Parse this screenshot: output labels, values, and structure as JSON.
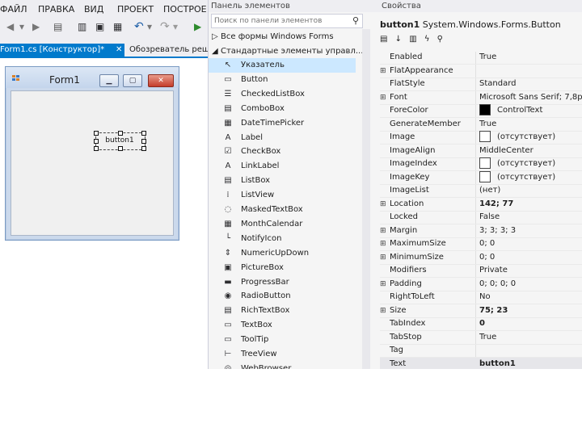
{
  "menu": [
    "ФАЙЛ",
    "ПРАВКА",
    "ВИД",
    "ПРОЕКТ",
    "ПОСТРОЕ"
  ],
  "tabs": {
    "active": "Form1.cs [Конструктор]*",
    "inactive": "Обозреватель реш"
  },
  "form": {
    "title": "Form1",
    "button_text": "button1"
  },
  "toolbox": {
    "header": "Панель элементов",
    "search_placeholder": "Поиск по панели элементов",
    "group_collapsed": "Все формы Windows Forms",
    "group_expanded": "Стандартные элементы управл...",
    "items": [
      {
        "label": "Указатель",
        "icon": "pointer-icon",
        "glyph": "↖"
      },
      {
        "label": "Button",
        "icon": "button-icon",
        "glyph": "▭"
      },
      {
        "label": "CheckedListBox",
        "icon": "checkedlistbox-icon",
        "glyph": "☰"
      },
      {
        "label": "ComboBox",
        "icon": "combobox-icon",
        "glyph": "▤"
      },
      {
        "label": "DateTimePicker",
        "icon": "calendar-icon",
        "glyph": "▦"
      },
      {
        "label": "Label",
        "icon": "label-icon",
        "glyph": "A"
      },
      {
        "label": "CheckBox",
        "icon": "checkbox-icon",
        "glyph": "☑"
      },
      {
        "label": "LinkLabel",
        "icon": "linklabel-icon",
        "glyph": "A"
      },
      {
        "label": "ListBox",
        "icon": "listbox-icon",
        "glyph": "▤"
      },
      {
        "label": "ListView",
        "icon": "listview-icon",
        "glyph": "⁞"
      },
      {
        "label": "MaskedTextBox",
        "icon": "maskedtextbox-icon",
        "glyph": "◌"
      },
      {
        "label": "MonthCalendar",
        "icon": "monthcalendar-icon",
        "glyph": "▦"
      },
      {
        "label": "NotifyIcon",
        "icon": "notifyicon-icon",
        "glyph": "└"
      },
      {
        "label": "NumericUpDown",
        "icon": "numericupdown-icon",
        "glyph": "⇕"
      },
      {
        "label": "PictureBox",
        "icon": "picturebox-icon",
        "glyph": "▣"
      },
      {
        "label": "ProgressBar",
        "icon": "progressbar-icon",
        "glyph": "▬"
      },
      {
        "label": "RadioButton",
        "icon": "radiobutton-icon",
        "glyph": "◉"
      },
      {
        "label": "RichTextBox",
        "icon": "richtextbox-icon",
        "glyph": "▤"
      },
      {
        "label": "TextBox",
        "icon": "textbox-icon",
        "glyph": "▭"
      },
      {
        "label": "ToolTip",
        "icon": "tooltip-icon",
        "glyph": "▭"
      },
      {
        "label": "TreeView",
        "icon": "treeview-icon",
        "glyph": "⊢"
      },
      {
        "label": "WebBrowser",
        "icon": "webbrowser-icon",
        "glyph": "◎"
      }
    ]
  },
  "properties": {
    "header": "Свойства",
    "object_name": "button1",
    "object_type": "System.Windows.Forms.Button",
    "rows": [
      {
        "name": "Enabled",
        "value": "True",
        "expander": ""
      },
      {
        "name": "FlatAppearance",
        "value": "",
        "expander": "⊞"
      },
      {
        "name": "FlatStyle",
        "value": "Standard",
        "expander": ""
      },
      {
        "name": "Font",
        "value": "Microsoft Sans Serif; 7,8pt",
        "expander": "⊞"
      },
      {
        "name": "ForeColor",
        "value": "ControlText",
        "expander": "",
        "swatch": "#000000"
      },
      {
        "name": "GenerateMember",
        "value": "True",
        "expander": ""
      },
      {
        "name": "Image",
        "value": "(отсутствует)",
        "expander": "",
        "swatch": "#ffffff"
      },
      {
        "name": "ImageAlign",
        "value": "MiddleCenter",
        "expander": ""
      },
      {
        "name": "ImageIndex",
        "value": "(отсутствует)",
        "expander": "",
        "swatch": "#ffffff"
      },
      {
        "name": "ImageKey",
        "value": "(отсутствует)",
        "expander": "",
        "swatch": "#ffffff"
      },
      {
        "name": "ImageList",
        "value": "(нет)",
        "expander": ""
      },
      {
        "name": "Location",
        "value": "142; 77",
        "expander": "⊞",
        "bold": true
      },
      {
        "name": "Locked",
        "value": "False",
        "expander": ""
      },
      {
        "name": "Margin",
        "value": "3; 3; 3; 3",
        "expander": "⊞"
      },
      {
        "name": "MaximumSize",
        "value": "0; 0",
        "expander": "⊞"
      },
      {
        "name": "MinimumSize",
        "value": "0; 0",
        "expander": "⊞"
      },
      {
        "name": "Modifiers",
        "value": "Private",
        "expander": ""
      },
      {
        "name": "Padding",
        "value": "0; 0; 0; 0",
        "expander": "⊞"
      },
      {
        "name": "RightToLeft",
        "value": "No",
        "expander": ""
      },
      {
        "name": "Size",
        "value": "75; 23",
        "expander": "⊞",
        "bold": true
      },
      {
        "name": "TabIndex",
        "value": "0",
        "expander": "",
        "bold": true
      },
      {
        "name": "TabStop",
        "value": "True",
        "expander": ""
      },
      {
        "name": "Tag",
        "value": "",
        "expander": ""
      },
      {
        "name": "Text",
        "value": "button1",
        "expander": "",
        "bold": true
      }
    ]
  },
  "colors": {
    "accent": "#007acc",
    "selection": "#cce8ff",
    "panel": "#f5f5f5",
    "chrome": "#eeeef2"
  }
}
